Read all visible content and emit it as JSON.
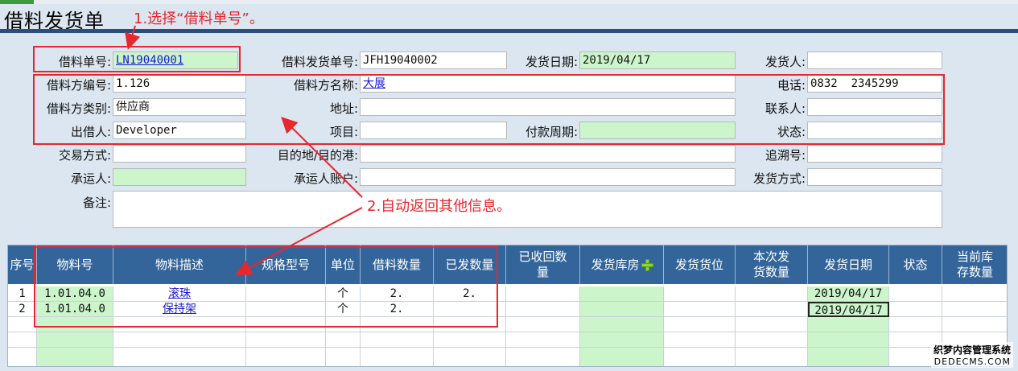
{
  "window": {
    "title": "借料发货单"
  },
  "annotations": {
    "step1": "1.选择“借料单号”。",
    "step2": "2.自动返回其他信息。"
  },
  "header": {
    "loan_no": {
      "label": "借料单号:",
      "value": "LN19040001"
    },
    "ship_no": {
      "label": "借料发货单号:",
      "value": "JFH19040002"
    },
    "ship_date": {
      "label": "发货日期:",
      "value": "2019/04/17"
    },
    "shipper": {
      "label": "发货人:",
      "value": ""
    },
    "borrower_code": {
      "label": "借料方编号:",
      "value": "1.126"
    },
    "borrower_name": {
      "label": "借料方名称:",
      "value": "大展"
    },
    "phone": {
      "label": "电话:",
      "value": "0832  2345299"
    },
    "borrower_type": {
      "label": "借料方类别:",
      "value": "供应商"
    },
    "address": {
      "label": "地址:",
      "value": ""
    },
    "contact": {
      "label": "联系人:",
      "value": ""
    },
    "lender": {
      "label": "出借人:",
      "value": "Developer"
    },
    "project": {
      "label": "项目:",
      "value": ""
    },
    "pay_cycle": {
      "label": "付款周期:",
      "value": ""
    },
    "status": {
      "label": "状态:",
      "value": ""
    },
    "trade_mode": {
      "label": "交易方式:",
      "value": ""
    },
    "destination": {
      "label": "目的地/目的港:",
      "value": ""
    },
    "trace_no": {
      "label": "追溯号:",
      "value": ""
    },
    "carrier": {
      "label": "承运人:",
      "value": ""
    },
    "carrier_account": {
      "label": "承运人账户:",
      "value": ""
    },
    "ship_method": {
      "label": "发货方式:",
      "value": ""
    },
    "remark": {
      "label": "备注:",
      "value": ""
    }
  },
  "grid": {
    "columns": [
      "序号",
      "物料号",
      "物料描述",
      "规格型号",
      "单位",
      "借料数量",
      "已发数量",
      "已收回数量",
      "发货库房",
      "发货货位",
      "本次发货数量",
      "发货日期",
      "状态",
      "当前库存数量"
    ],
    "rows": [
      [
        "1",
        "1.01.04.0",
        "滚珠",
        "",
        "个",
        "2.",
        "2.",
        "",
        "",
        "",
        "",
        "2019/04/17",
        "",
        ""
      ],
      [
        "2",
        "1.01.04.0",
        "保持架",
        "",
        "个",
        "2.",
        "",
        "",
        "",
        "",
        "",
        "2019/04/17",
        "",
        ""
      ]
    ]
  },
  "icons": {
    "add_warehouse": "plus-icon"
  },
  "watermark": {
    "line1": "织梦内容管理系统",
    "line2": "DEDECMS.COM"
  }
}
